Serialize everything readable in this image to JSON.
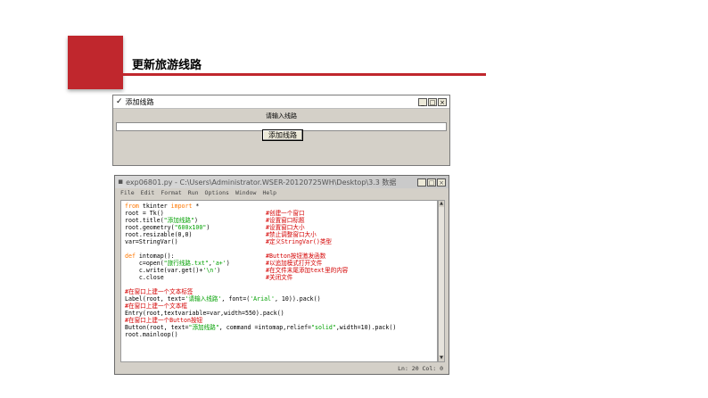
{
  "slide": {
    "title": "更新旅游线路"
  },
  "tk_window": {
    "title": "添加线路",
    "label": "请输入线路",
    "entry_value": "",
    "button_label": "添加线路",
    "controls": [
      "_",
      "□",
      "×"
    ]
  },
  "editor": {
    "title": "exp06801.py - C:\\Users\\Administrator.WSER-20120725WH\\Desktop\\3.3 数据",
    "menu": [
      "File",
      "Edit",
      "Format",
      "Run",
      "Options",
      "Window",
      "Help"
    ],
    "status": "Ln: 20  Col: 0",
    "code": {
      "l1": [
        "from",
        " tkinter ",
        "import",
        " *"
      ],
      "l2": "root = Tk()",
      "l2c": "#创建一个窗口",
      "l3": [
        "root.title(",
        "\"添加线路\"",
        ")"
      ],
      "l3c": "#设置窗口标题",
      "l4": [
        "root.geometry(",
        "\"600x100\"",
        ")"
      ],
      "l4c": "#设置窗口大小",
      "l5": "root.resizable(0,0)",
      "l5c": "#禁止调整窗口大小",
      "l6": "var=StringVar()",
      "l6c": "#定义StringVar()类型",
      "l7": [
        "def",
        " intomap():"
      ],
      "l7c": "#Button按钮激发函数",
      "l8": [
        "    c=open(",
        "\"旅行线路.txt\"",
        ",",
        "'a+'",
        ")"
      ],
      "l8c": "#以追加模式打开文件",
      "l9": [
        "    c.write(var.get()+",
        "'\\n'",
        ")"
      ],
      "l9c": "#在文件末尾添加text里的内容",
      "l10": "    c.close",
      "l10c": "#关闭文件",
      "l11": "#在窗口上建一个文本标签",
      "l12": [
        "Label(root, text=",
        "'请输入线路'",
        ", font=(",
        "'Arial'",
        ", 10)).pack()"
      ],
      "l13": "#在窗口上建一个文本框",
      "l14": "Entry(root,textvariable=var,width=550).pack()",
      "l15": "#在窗口上建一个Button按钮",
      "l16": [
        "Button(root, text=",
        "\"添加线路\"",
        ", command =intomap,relief=",
        "\"solid\"",
        ",width=10).pack()"
      ],
      "l17": "root.mainloop()"
    }
  }
}
